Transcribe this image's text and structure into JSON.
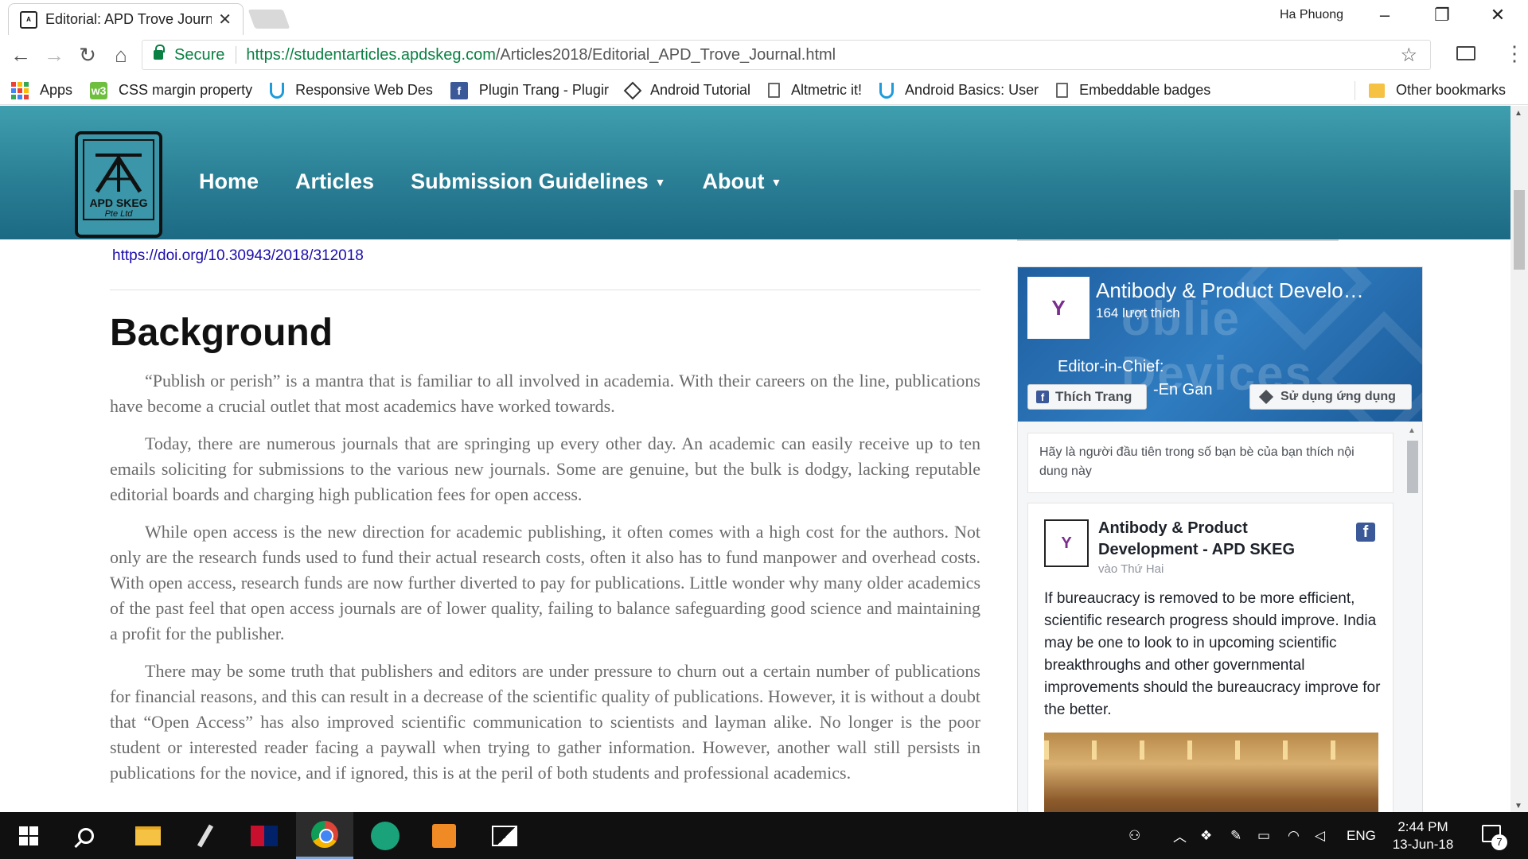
{
  "browser": {
    "tab_title": "Editorial: APD Trove Journ",
    "tab_close": "✕",
    "profile_name": "Ha Phuong",
    "url_host": "https://studentarticles.apdskeg.com",
    "url_path": "/Articles2018/Editorial_APD_Trove_Journal.html",
    "secure_label": "Secure",
    "bookmarks": [
      {
        "label": "Apps",
        "icon": "apps-grid-icon"
      },
      {
        "label": "CSS margin property",
        "icon": "w3-icon"
      },
      {
        "label": "Responsive Web Des",
        "icon": "udacity-icon"
      },
      {
        "label": "Plugin Trang - Plugir",
        "icon": "facebook-icon"
      },
      {
        "label": "Android Tutorial",
        "icon": "diamond-icon"
      },
      {
        "label": "Altmetric it!",
        "icon": "page-icon"
      },
      {
        "label": "Android Basics: User",
        "icon": "udacity-icon"
      },
      {
        "label": "Embeddable badges",
        "icon": "page-icon"
      }
    ],
    "other_bookmarks": "Other bookmarks"
  },
  "site": {
    "logo_line1": "APD SKEG",
    "logo_line2": "Pte Ltd",
    "nav": {
      "home": "Home",
      "articles": "Articles",
      "submission": "Submission Guidelines",
      "about": "About"
    }
  },
  "article": {
    "doi": "https://doi.org/10.30943/2018/312018",
    "heading": "Background",
    "paragraphs": [
      "“Publish or perish” is a mantra that is familiar to all involved in academia. With their careers on the line, publications have become a crucial outlet that most academics have worked towards.",
      "Today, there are numerous journals that are springing up every other day. An academic can easily receive up to ten emails soliciting for submissions to the various new journals. Some are genuine, but the bulk is dodgy, lacking reputable editorial boards and charging high publication fees for open access.",
      "While open access is the new direction for academic publishing, it often comes with a high cost for the authors. Not only are the research funds used to fund their actual research costs, often it also has to fund manpower and overhead costs. With open access, research funds are now further diverted to pay for publications. Little wonder why many older academics of the past feel that open access journals are of lower quality, failing to balance safeguarding good science and maintaining a profit for the publisher.",
      "There may be some truth that publishers and editors are under pressure to churn out a certain number of publications for financial reasons, and this can result in a decrease of the scientific quality of publications. However, it is without a doubt that “Open Access” has also improved scientific communication to scientists and layman alike. No longer is the poor student or interested reader facing a paywall when trying to gather information. However, another wall still persists in publications for the novice, and if ignored, this is at the peril of both students and professional academics."
    ]
  },
  "facebook": {
    "page_name": "Antibody & Product Develo…",
    "likes": "164 lượt thích",
    "cover_text": "oblie Devices",
    "cover_editor": "Editor-in-Chief:",
    "cover_editor_name": "-En Gan",
    "like_button": "Thích Trang",
    "use_app_button": "Sử dụng ứng dụng",
    "friends_prompt": "Hãy là người đầu tiên trong số bạn bè của bạn thích nội dung này",
    "post_author": "Antibody & Product Development - APD SKEG",
    "post_date": "vào Thứ Hai",
    "post_text": "If bureaucracy is removed to be more efficient, scientific research progress should improve. India may be one to look to in upcoming scientific breakthroughs and other governmental improvements should the bureaucracy improve for the better."
  },
  "taskbar": {
    "lang": "ENG",
    "time": "2:44 PM",
    "date": "13-Jun-18",
    "notification_count": "7"
  }
}
